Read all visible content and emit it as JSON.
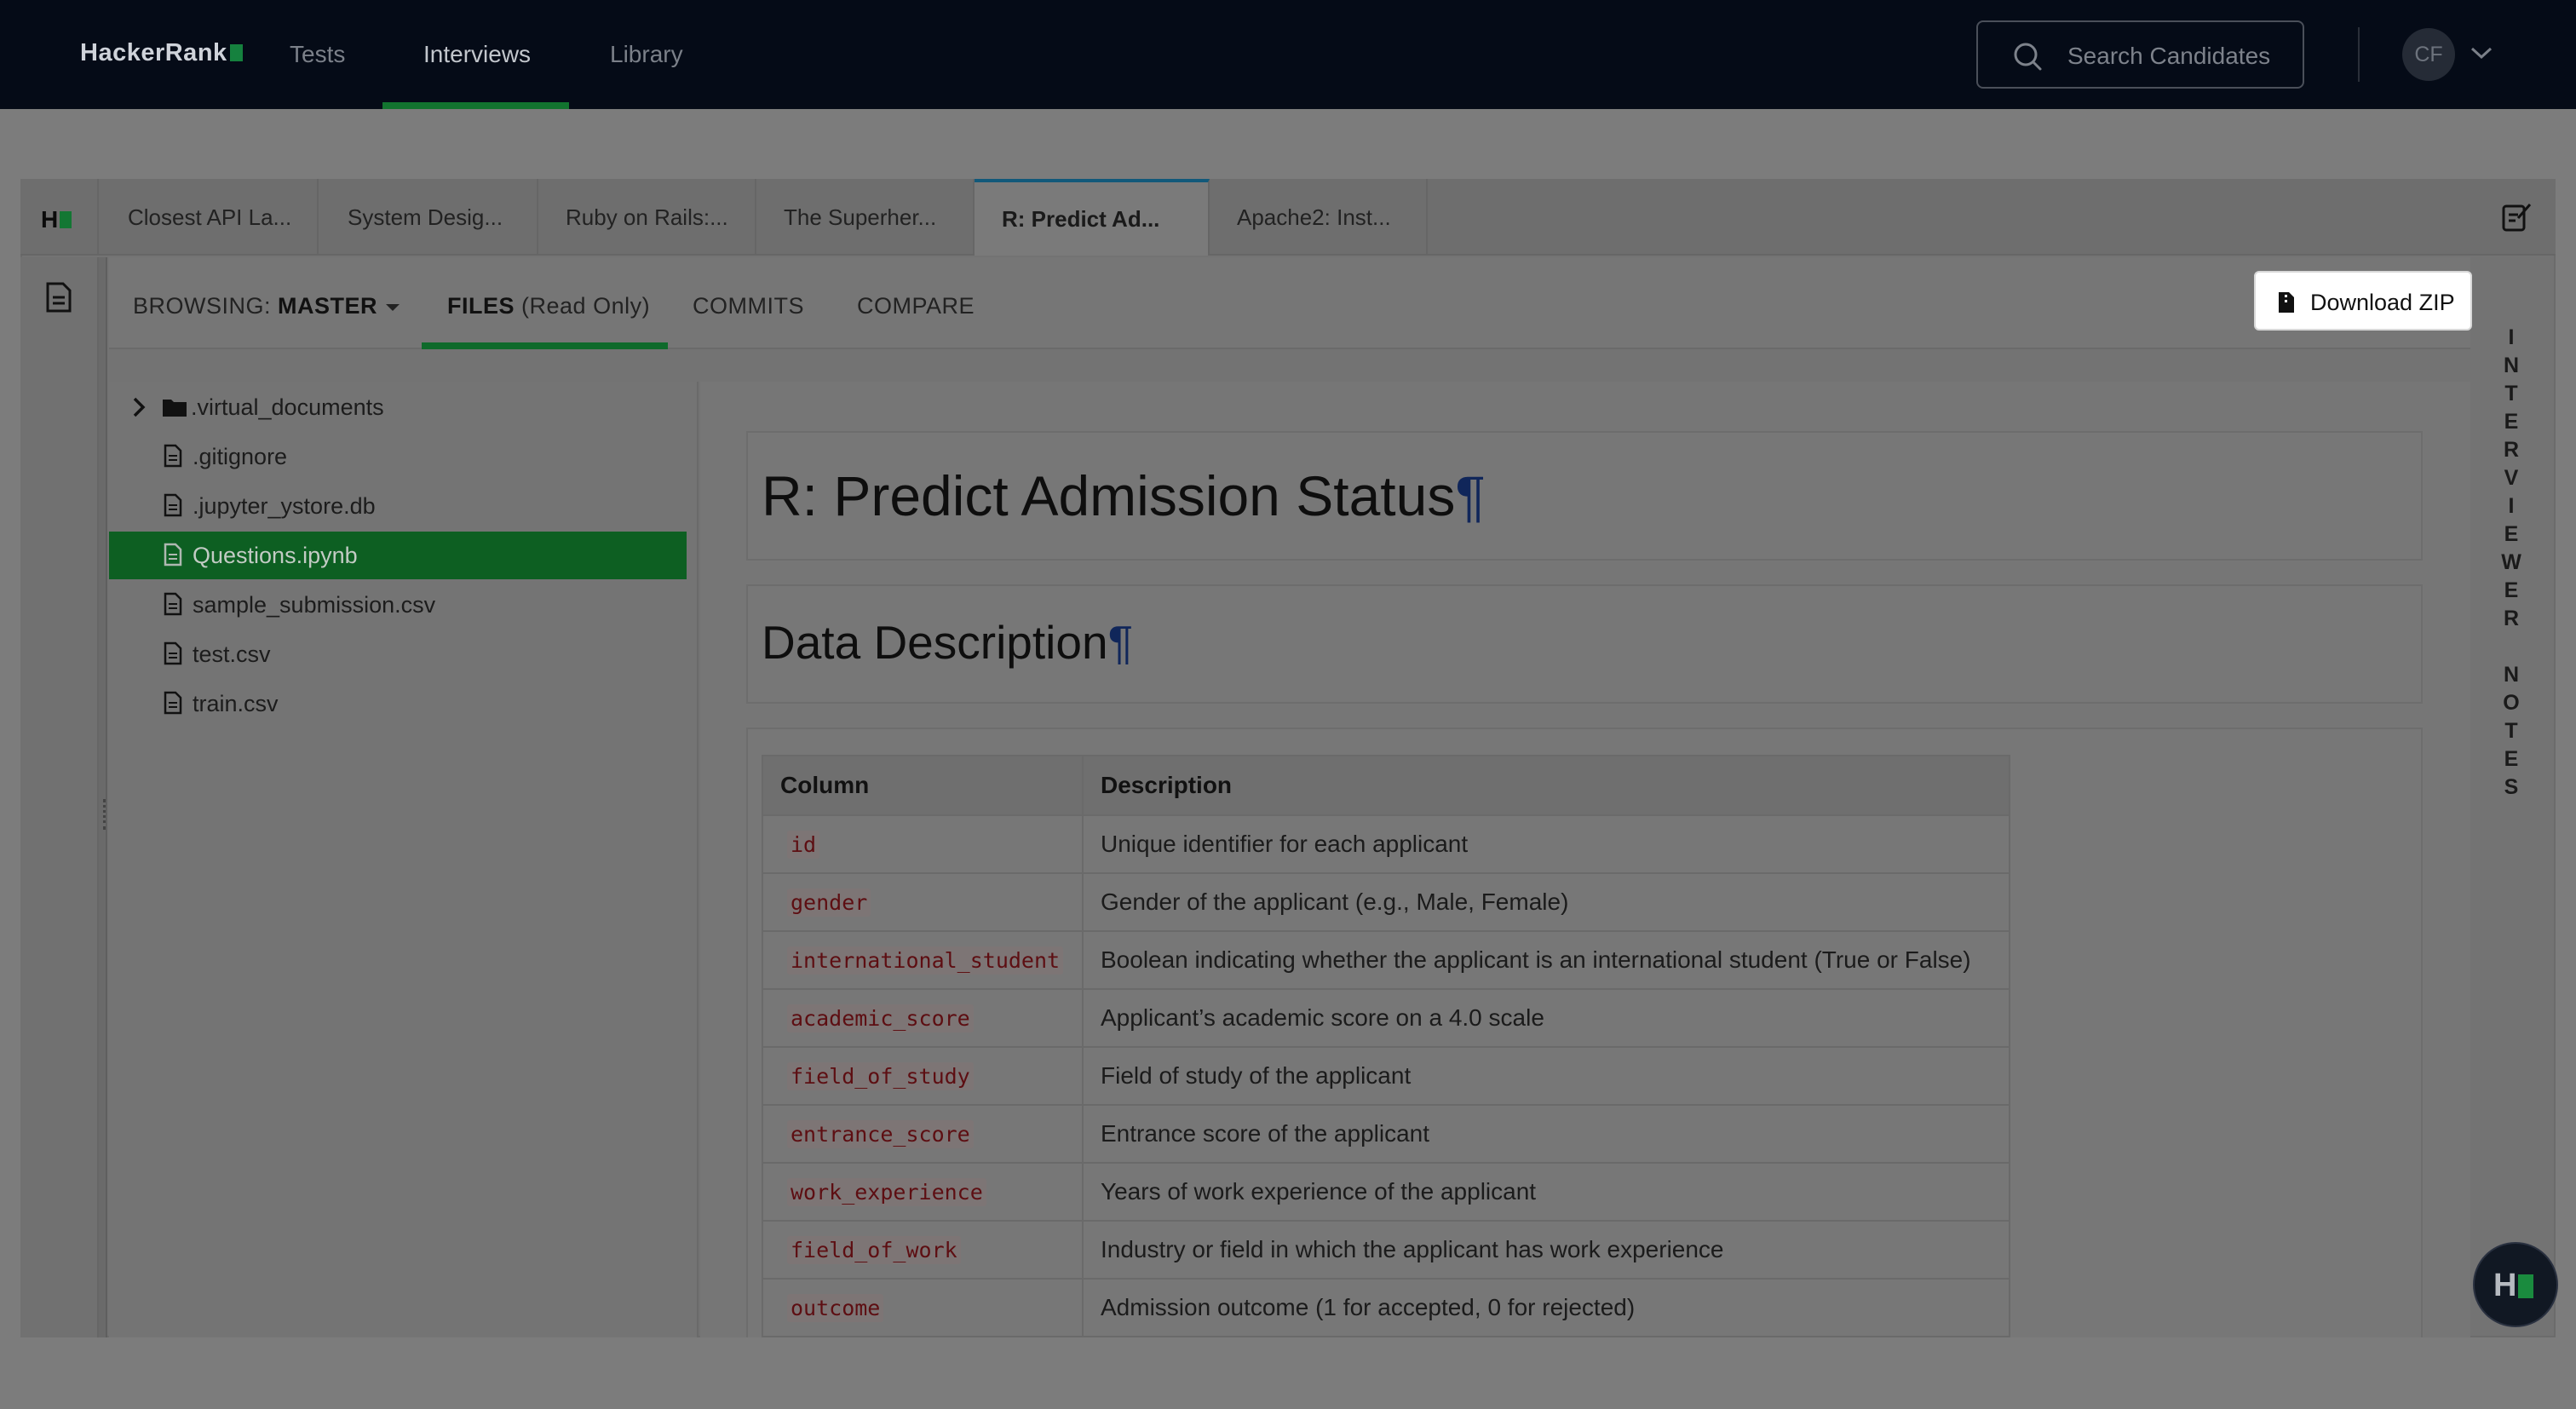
{
  "topnav": {
    "brand": "HackerRank",
    "links": [
      "Tests",
      "Interviews",
      "Library"
    ],
    "active_link": "Interviews",
    "search_placeholder": "Search Candidates",
    "avatar_initials": "CF"
  },
  "file_tabs": [
    "Closest API La...",
    "System Desig...",
    "Ruby on Rails:...",
    "The Superher...",
    "R: Predict Ad...",
    "Apache2: Inst..."
  ],
  "active_file_tab": "R: Predict Ad...",
  "browser": {
    "browsing_label": "BROWSING:",
    "branch": "MASTER",
    "files_label": "FILES",
    "files_suffix": "(Read Only)",
    "commits_label": "COMMITS",
    "compare_label": "COMPARE",
    "download_label": "Download ZIP"
  },
  "side_panel_label": "INTERVIEWER NOTES",
  "tree": [
    {
      "name": ".virtual_documents",
      "type": "folder"
    },
    {
      "name": ".gitignore",
      "type": "file"
    },
    {
      "name": ".jupyter_ystore.db",
      "type": "file"
    },
    {
      "name": "Questions.ipynb",
      "type": "file",
      "selected": true
    },
    {
      "name": "sample_submission.csv",
      "type": "file"
    },
    {
      "name": "test.csv",
      "type": "file"
    },
    {
      "name": "train.csv",
      "type": "file"
    }
  ],
  "notebook": {
    "title": "R: Predict Admission Status",
    "pilcrow": "¶",
    "section": "Data Description",
    "table_headers": [
      "Column",
      "Description"
    ],
    "table_rows": [
      [
        "id",
        "Unique identifier for each applicant"
      ],
      [
        "gender",
        "Gender of the applicant (e.g., Male, Female)"
      ],
      [
        "international_student",
        "Boolean indicating whether the applicant is an international student (True or False)"
      ],
      [
        "academic_score",
        "Applicant’s academic score on a 4.0 scale"
      ],
      [
        "field_of_study",
        "Field of study of the applicant"
      ],
      [
        "entrance_score",
        "Entrance score of the applicant"
      ],
      [
        "work_experience",
        "Years of work experience of the applicant"
      ],
      [
        "field_of_work",
        "Industry or field in which the applicant has work experience"
      ],
      [
        "outcome",
        "Admission outcome (1 for accepted, 0 for rejected)"
      ]
    ]
  },
  "fab_label": "H"
}
